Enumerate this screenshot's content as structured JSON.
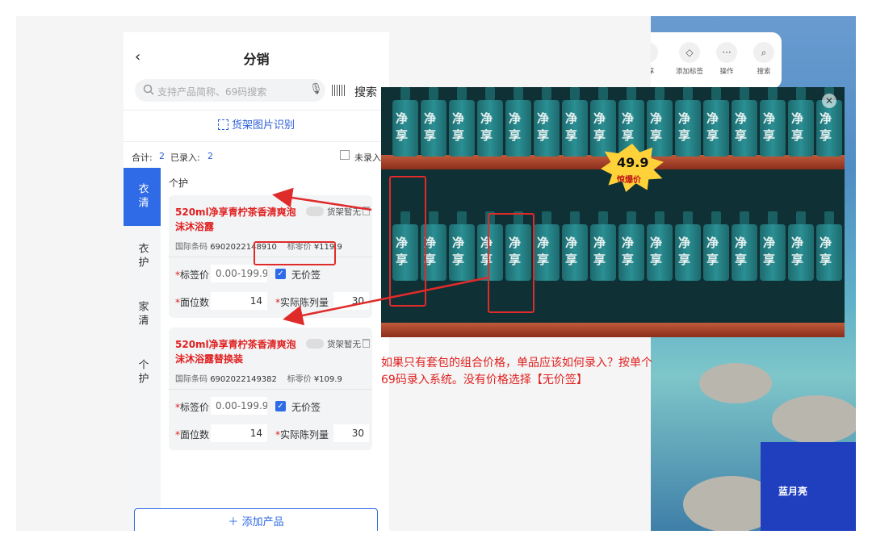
{
  "phone": {
    "back_glyph": "‹",
    "title": "分销",
    "search": {
      "placeholder": "支持产品简称、69码搜索",
      "button": "搜索"
    },
    "shelf_recognition": "货架图片识别",
    "summary": {
      "total_label": "合计:",
      "total_value": "2",
      "entered_label": "已录入:",
      "entered_value": "2",
      "not_entered_label": "未录入"
    },
    "sidebar": [
      {
        "label": "衣清",
        "active": true
      },
      {
        "label": "衣护",
        "active": false
      },
      {
        "label": "家清",
        "active": false
      },
      {
        "label": "个护",
        "active": false
      }
    ],
    "category_title": "个护",
    "products": [
      {
        "name": "520ml净享青柠茶香清爽泡沫沐浴露",
        "shelf_none": "货架暂无",
        "barcode_label": "国际条码",
        "barcode": "6902022148910",
        "retail_label": "标零价",
        "retail_price": "¥119.9",
        "tag_price_label": "标签价",
        "tag_price_placeholder": "0.00-199.9",
        "no_tag_label": "无价签",
        "facing_label": "面位数",
        "facing_value": "14",
        "display_label": "实际陈列量",
        "display_value": "30"
      },
      {
        "name": "520ml净享青柠茶香清爽泡沫沐浴露替换装",
        "shelf_none": "货架暂无",
        "barcode_label": "国际条码",
        "barcode": "6902022149382",
        "retail_label": "标零价",
        "retail_price": "¥109.9",
        "tag_price_label": "标签价",
        "tag_price_placeholder": "0.00-199.9",
        "no_tag_label": "无价签",
        "facing_label": "面位数",
        "facing_value": "14",
        "display_label": "实际陈列量",
        "display_value": "30"
      }
    ],
    "add_product": "添加产品"
  },
  "toolbar": [
    {
      "label": "分享",
      "icon": "share-icon"
    },
    {
      "label": "添加标签",
      "icon": "tag-icon"
    },
    {
      "label": "操作",
      "icon": "more-icon"
    },
    {
      "label": "搜索",
      "icon": "search-icon"
    }
  ],
  "photo": {
    "logo_text": "净享",
    "price_tag_main": "49.9",
    "price_tag_sub": "惊爆价",
    "overlay_brand": "蓝月亮"
  },
  "annotation": "如果只有套包的组合价格，单品应该如何录入？按单个69码录入系统。没有价格选择【无价签】",
  "colors": {
    "accent": "#2f6be6",
    "highlight": "#e02b2b"
  }
}
